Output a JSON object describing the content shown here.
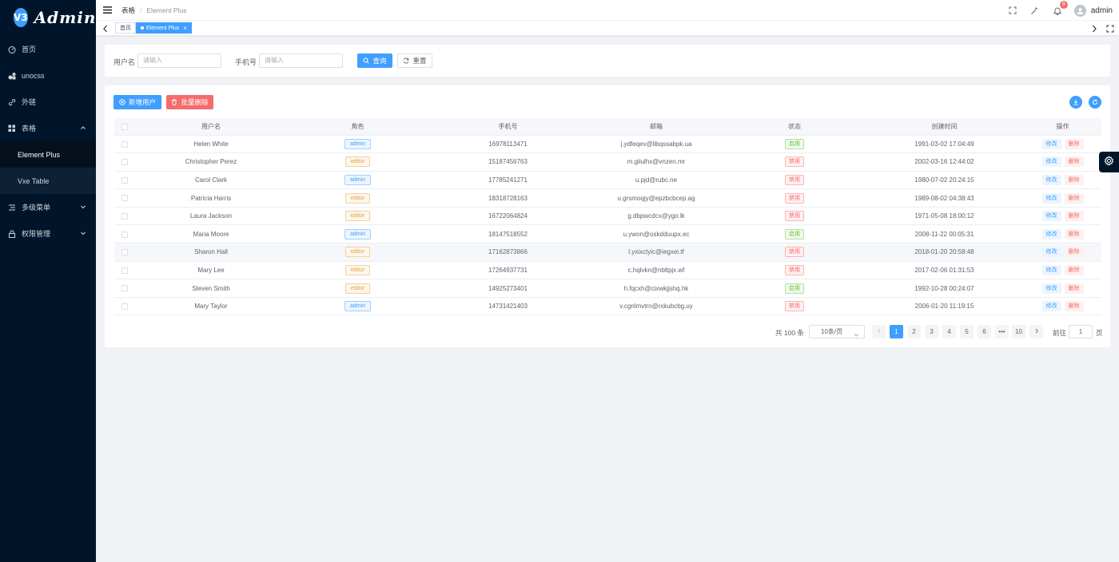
{
  "app": {
    "logo_badge": "V3",
    "logo_text": "Admin"
  },
  "sidebar": {
    "items": [
      {
        "label": "首页",
        "icon": "dashboard-icon"
      },
      {
        "label": "unocss",
        "icon": "unocss-icon"
      },
      {
        "label": "外链",
        "icon": "link-icon"
      },
      {
        "label": "表格",
        "icon": "grid-icon",
        "expanded": true
      },
      {
        "label": "Element Plus",
        "sub": true,
        "active": true
      },
      {
        "label": "Vxe Table",
        "sub": true
      },
      {
        "label": "多级菜单",
        "icon": "menu-icon"
      },
      {
        "label": "权限管理",
        "icon": "lock-icon"
      }
    ]
  },
  "header": {
    "breadcrumb": [
      "表格",
      "Element Plus"
    ],
    "notification_count": "8",
    "username": "admin"
  },
  "tags": {
    "home": "首页",
    "active": "Element Plus"
  },
  "search": {
    "username_label": "用户名",
    "username_placeholder": "请输入",
    "phone_label": "手机号",
    "phone_placeholder": "请输入",
    "query_label": "查询",
    "reset_label": "重置"
  },
  "toolbar": {
    "add_label": "新增用户",
    "batch_delete_label": "批量删除"
  },
  "table": {
    "columns": [
      "用户名",
      "角色",
      "手机号",
      "邮箱",
      "状态",
      "创建时间",
      "操作"
    ],
    "edit_label": "修改",
    "delete_label": "删除",
    "rows": [
      {
        "name": "Helen White",
        "role": "admin",
        "phone": "16978113471",
        "email": "j.ydfeqev@libqssabpk.ua",
        "status": "启用",
        "created": "1991-03-02 17:04:49"
      },
      {
        "name": "Christopher Perez",
        "role": "editor",
        "phone": "15187456763",
        "email": "m.giiulhx@vnzen.mr",
        "status": "禁用",
        "created": "2002-03-16 12:44:02"
      },
      {
        "name": "Carol Clark",
        "role": "admin",
        "phone": "17785241271",
        "email": "u.pjd@rubc.ne",
        "status": "禁用",
        "created": "1980-07-02 20:24:15"
      },
      {
        "name": "Patricia Harris",
        "role": "editor",
        "phone": "18318728163",
        "email": "u.grsmoqjy@epzbcbcep.ag",
        "status": "禁用",
        "created": "1989-08-02 04:38:43"
      },
      {
        "name": "Laura Jackson",
        "role": "editor",
        "phone": "16722064824",
        "email": "g.dbpwcdcx@ygo.lk",
        "status": "禁用",
        "created": "1971-05-08 18:00:12"
      },
      {
        "name": "Maria Moore",
        "role": "admin",
        "phone": "18147518552",
        "email": "u.ywon@oskdduupx.ec",
        "status": "启用",
        "created": "2008-11-22 00:05:31"
      },
      {
        "name": "Sharon Hall",
        "role": "editor",
        "phone": "17162873866",
        "email": "l.yxixctyic@iegxei.tf",
        "status": "禁用",
        "created": "2018-01-20 20:58:48"
      },
      {
        "name": "Mary Lee",
        "role": "editor",
        "phone": "17264937731",
        "email": "c.hqlvkn@nbltpjx.wf",
        "status": "禁用",
        "created": "2017-02-06 01:31:53"
      },
      {
        "name": "Steven Smith",
        "role": "editor",
        "phone": "14925273401",
        "email": "h.fqcxh@cixwkjjshq.hk",
        "status": "启用",
        "created": "1992-10-28 00:24:07"
      },
      {
        "name": "Mary Taylor",
        "role": "admin",
        "phone": "14731421403",
        "email": "v.cgnlmvtrn@rxkubcbg.uy",
        "status": "禁用",
        "created": "2006-01-20 11:19:15"
      }
    ]
  },
  "pagination": {
    "total_text": "共 100 条",
    "page_size": "10条/页",
    "pages": [
      "1",
      "2",
      "3",
      "4",
      "5",
      "6",
      "•••",
      "10"
    ],
    "current": "1",
    "goto_label": "前往",
    "goto_value": "1",
    "page_suffix": "页"
  },
  "colors": {
    "primary": "#409eff",
    "danger": "#f56c6c",
    "success": "#67c23a",
    "warning": "#e6a23c",
    "sidebar": "#001529"
  }
}
